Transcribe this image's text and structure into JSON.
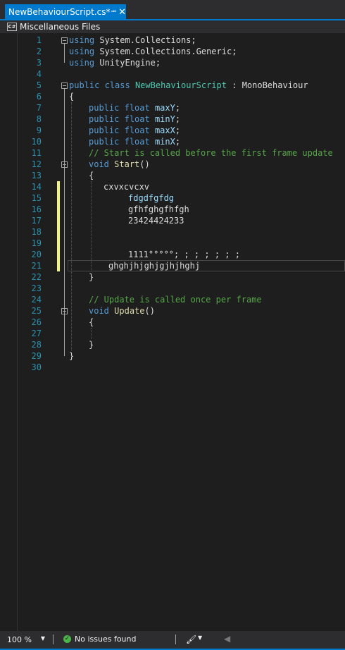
{
  "tab": {
    "title": "NewBehaviourScript.cs*",
    "pin_icon": "pin-icon",
    "close_icon": "close-icon"
  },
  "navbar": {
    "icon_label": "C#",
    "label": "Miscellaneous Files"
  },
  "colors": {
    "accent": "#007acc",
    "editor_bg": "#1e1e1e",
    "line_number": "#2b91af",
    "keyword": "#569cd6",
    "type": "#4ec9b0",
    "field": "#9cdcfe",
    "method": "#dcdcaa",
    "comment": "#57a64a",
    "change_marker": "#eff281"
  },
  "lines": [
    {
      "n": "1",
      "segs": [
        [
          "kw",
          "using"
        ],
        [
          "tx",
          " System.Collections;"
        ]
      ]
    },
    {
      "n": "2",
      "segs": [
        [
          "kw",
          "using"
        ],
        [
          "tx",
          " System.Collections.Generic;"
        ]
      ]
    },
    {
      "n": "3",
      "segs": [
        [
          "kw",
          "using"
        ],
        [
          "tx",
          " UnityEngine;"
        ]
      ]
    },
    {
      "n": "4",
      "segs": []
    },
    {
      "n": "5",
      "segs": [
        [
          "kw",
          "public"
        ],
        [
          "tx",
          " "
        ],
        [
          "kw",
          "class"
        ],
        [
          "tx",
          " "
        ],
        [
          "ty",
          "NewBehaviourScript"
        ],
        [
          "tx",
          " : "
        ],
        [
          "tx",
          "MonoBehaviour"
        ]
      ]
    },
    {
      "n": "6",
      "segs": [
        [
          "tx",
          "{"
        ]
      ]
    },
    {
      "n": "7",
      "segs": [
        [
          "kw",
          "public"
        ],
        [
          "tx",
          " "
        ],
        [
          "kw",
          "float"
        ],
        [
          "tx",
          " "
        ],
        [
          "fld",
          "maxY"
        ],
        [
          "tx",
          ";"
        ]
      ]
    },
    {
      "n": "8",
      "segs": [
        [
          "kw",
          "public"
        ],
        [
          "tx",
          " "
        ],
        [
          "kw",
          "float"
        ],
        [
          "tx",
          " "
        ],
        [
          "fld",
          "minY"
        ],
        [
          "tx",
          ";"
        ]
      ]
    },
    {
      "n": "9",
      "segs": [
        [
          "kw",
          "public"
        ],
        [
          "tx",
          " "
        ],
        [
          "kw",
          "float"
        ],
        [
          "tx",
          " "
        ],
        [
          "fld",
          "maxX"
        ],
        [
          "tx",
          ";"
        ]
      ]
    },
    {
      "n": "10",
      "segs": [
        [
          "kw",
          "public"
        ],
        [
          "tx",
          " "
        ],
        [
          "kw",
          "float"
        ],
        [
          "tx",
          " "
        ],
        [
          "fld",
          "minX"
        ],
        [
          "tx",
          ";"
        ]
      ]
    },
    {
      "n": "11",
      "segs": [
        [
          "cm",
          "// Start is called before the first frame update"
        ]
      ]
    },
    {
      "n": "12",
      "segs": [
        [
          "kw",
          "void"
        ],
        [
          "tx",
          " "
        ],
        [
          "mth",
          "Start"
        ],
        [
          "tx",
          "()"
        ]
      ]
    },
    {
      "n": "13",
      "segs": [
        [
          "tx",
          "{"
        ]
      ]
    },
    {
      "n": "14",
      "segs": [
        [
          "tx",
          "cxvxcvcxv"
        ]
      ]
    },
    {
      "n": "15",
      "segs": [
        [
          "fld",
          "fdgdfgfdg"
        ]
      ]
    },
    {
      "n": "16",
      "segs": [
        [
          "tx",
          "gfhfghgfhfgh"
        ]
      ]
    },
    {
      "n": "17",
      "segs": [
        [
          "tx",
          "23424424233"
        ]
      ]
    },
    {
      "n": "18",
      "segs": []
    },
    {
      "n": "19",
      "segs": []
    },
    {
      "n": "20",
      "segs": [
        [
          "tx",
          "1111°°°°°; ; ; ; ; ; ;"
        ]
      ]
    },
    {
      "n": "21",
      "segs": [
        [
          "tx",
          "ghghjhjghjgjhjhghj"
        ]
      ]
    },
    {
      "n": "22",
      "segs": [
        [
          "tx",
          "}"
        ]
      ]
    },
    {
      "n": "23",
      "segs": []
    },
    {
      "n": "24",
      "segs": [
        [
          "cm",
          "// Update is called once per frame"
        ]
      ]
    },
    {
      "n": "25",
      "segs": [
        [
          "kw",
          "void"
        ],
        [
          "tx",
          " "
        ],
        [
          "mth",
          "Update"
        ],
        [
          "tx",
          "()"
        ]
      ]
    },
    {
      "n": "26",
      "segs": [
        [
          "tx",
          "{"
        ]
      ]
    },
    {
      "n": "27",
      "segs": []
    },
    {
      "n": "28",
      "segs": [
        [
          "tx",
          "}"
        ]
      ]
    },
    {
      "n": "29",
      "segs": [
        [
          "tx",
          "}"
        ]
      ]
    },
    {
      "n": "30",
      "segs": []
    }
  ],
  "status": {
    "zoom": "100 %",
    "issues": "No issues found",
    "ok_icon": "check-circle-icon",
    "brush_icon": "brush-icon"
  }
}
